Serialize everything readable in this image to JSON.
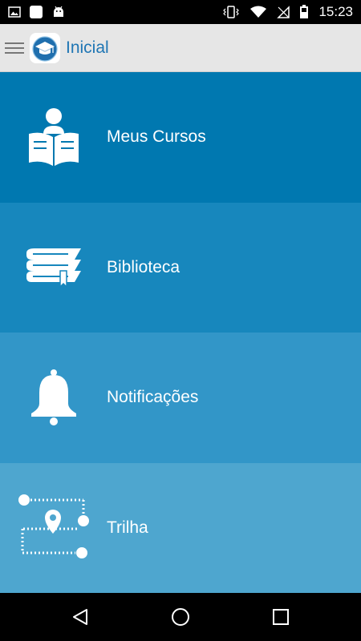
{
  "status_bar": {
    "time": "15:23",
    "left_icons": [
      "image-icon",
      "app-square-icon",
      "android-icon"
    ],
    "right_icons": [
      "vibrate-icon",
      "wifi-icon",
      "no-sim-icon",
      "battery-icon"
    ]
  },
  "app_bar": {
    "title": "Inicial",
    "title_color": "#1f76b4"
  },
  "menu": {
    "items": [
      {
        "label": "Meus Cursos",
        "icon": "reader-book-icon",
        "color": "#0078b0"
      },
      {
        "label": "Biblioteca",
        "icon": "books-stack-icon",
        "color": "#1787bd"
      },
      {
        "label": "Notificações",
        "icon": "bell-icon",
        "color": "#3296c8"
      },
      {
        "label": "Trilha",
        "icon": "route-map-icon",
        "color": "#4ea6cf"
      }
    ]
  },
  "nav_bar": {
    "buttons": [
      "back-icon",
      "home-icon",
      "recents-icon"
    ]
  }
}
